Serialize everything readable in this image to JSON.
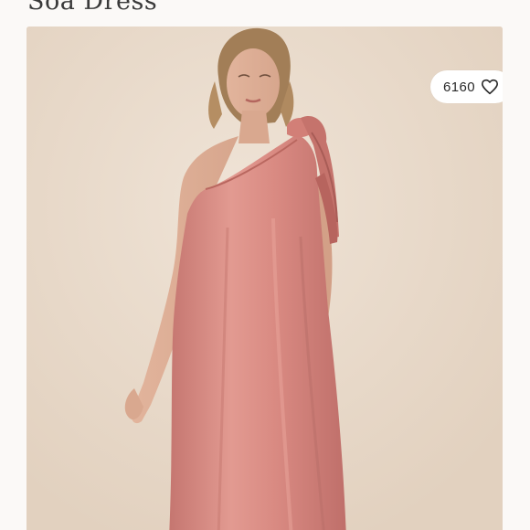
{
  "listing": {
    "title": "Soa Dress",
    "likes": "6160"
  },
  "icons": {
    "like": "heart-outline-icon"
  },
  "colors": {
    "background": "#fbf9f7",
    "photo_backdrop": "#e8d9c9",
    "dress": "#d68880"
  }
}
